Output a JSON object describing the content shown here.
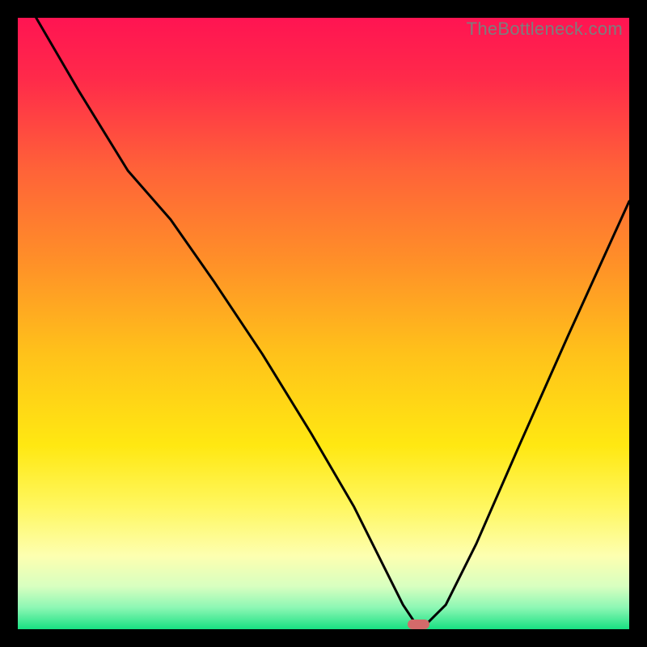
{
  "watermark": "TheBottleneck.com",
  "chart_data": {
    "type": "line",
    "title": "",
    "xlabel": "",
    "ylabel": "",
    "xlim": [
      0,
      100
    ],
    "ylim": [
      0,
      100
    ],
    "grid": false,
    "legend": false,
    "series": [
      {
        "name": "bottleneck-curve",
        "x": [
          3,
          10,
          18,
          25,
          32,
          40,
          48,
          55,
          60,
          63,
          65,
          67,
          70,
          75,
          82,
          90,
          100
        ],
        "y": [
          100,
          88,
          75,
          67,
          57,
          45,
          32,
          20,
          10,
          4,
          1,
          1,
          4,
          14,
          30,
          48,
          70
        ]
      }
    ],
    "marker": {
      "name": "optimal-range",
      "x": 65.5,
      "y": 0.8,
      "width_pct": 3.6,
      "height_pct": 1.6,
      "color": "#d46a6a"
    },
    "gradient_stops": [
      {
        "offset": 0.0,
        "color": "#ff1452"
      },
      {
        "offset": 0.1,
        "color": "#ff2a4a"
      },
      {
        "offset": 0.25,
        "color": "#ff6338"
      },
      {
        "offset": 0.4,
        "color": "#ff9028"
      },
      {
        "offset": 0.55,
        "color": "#ffc21a"
      },
      {
        "offset": 0.7,
        "color": "#ffe812"
      },
      {
        "offset": 0.8,
        "color": "#fff760"
      },
      {
        "offset": 0.88,
        "color": "#fdffb0"
      },
      {
        "offset": 0.93,
        "color": "#d8ffc0"
      },
      {
        "offset": 0.965,
        "color": "#8cf7b4"
      },
      {
        "offset": 1.0,
        "color": "#18e082"
      }
    ]
  }
}
